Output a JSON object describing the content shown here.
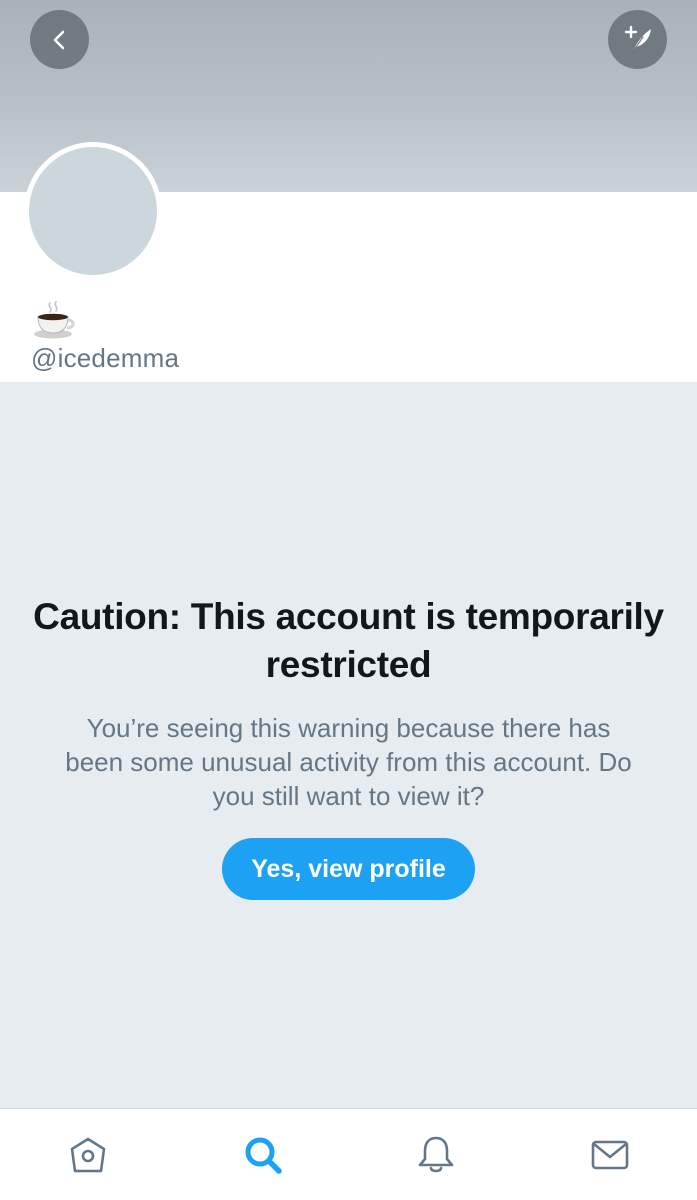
{
  "header": {
    "back_icon": "chevron-left-icon",
    "compose_icon": "compose-feather-icon"
  },
  "profile": {
    "emoji": "☕",
    "handle": "@icedemma"
  },
  "warning": {
    "title": "Caution: This account is temporarily restricted",
    "body": "You’re seeing this warning because there has been some unusual activity from this account. Do you still want to view it?",
    "button_label": "Yes, view profile"
  },
  "tabbar": {
    "tabs": [
      {
        "name": "home",
        "icon": "home-icon",
        "active": false
      },
      {
        "name": "search",
        "icon": "search-icon",
        "active": true
      },
      {
        "name": "notifications",
        "icon": "bell-icon",
        "active": false
      },
      {
        "name": "messages",
        "icon": "envelope-icon",
        "active": false
      }
    ]
  },
  "colors": {
    "accent": "#1da1f2",
    "background": "#e6ecf0",
    "secondary_text": "#657786",
    "primary_text": "#14171a",
    "inactive_icon": "#657786"
  }
}
